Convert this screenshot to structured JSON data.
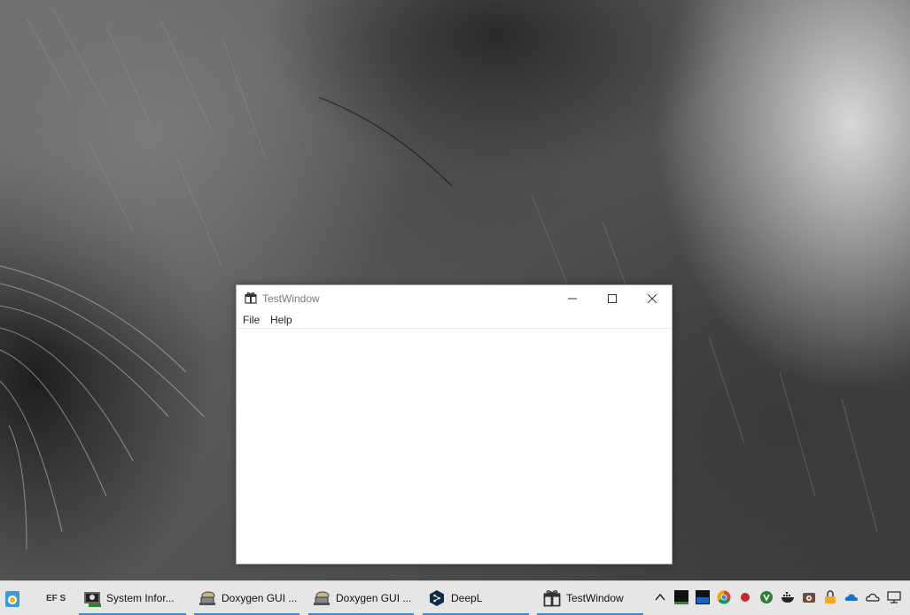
{
  "window": {
    "title": "TestWindow",
    "menu": [
      "File",
      "Help"
    ]
  },
  "taskbar": {
    "efs_label": "EF S",
    "items": [
      {
        "label": "System Infor...",
        "icon": "system-information-icon",
        "active": true
      },
      {
        "label": "Doxygen GUI ...",
        "icon": "doxygen-icon",
        "active": true
      },
      {
        "label": "Doxygen GUI ...",
        "icon": "doxygen-icon",
        "active": true
      },
      {
        "label": "DeepL",
        "icon": "deepl-icon",
        "active": true
      },
      {
        "label": "TestWindow",
        "icon": "gift-icon",
        "active": true
      }
    ],
    "tray_icons": [
      "show-hidden-icons-chevron",
      "black-square-icon",
      "blue-window-icon",
      "chrome-icon",
      "red-dot-icon",
      "green-app-icon",
      "docker-whale-icon",
      "camera-app-icon",
      "lock-app-icon",
      "onedrive-blue-cloud-icon",
      "onedrive-grey-cloud-icon",
      "network-icon"
    ]
  },
  "colors": {
    "taskbar_bg": "#e6e6e6",
    "taskbar_accent": "#3a8ad6",
    "title_text": "#7a7a7a"
  }
}
